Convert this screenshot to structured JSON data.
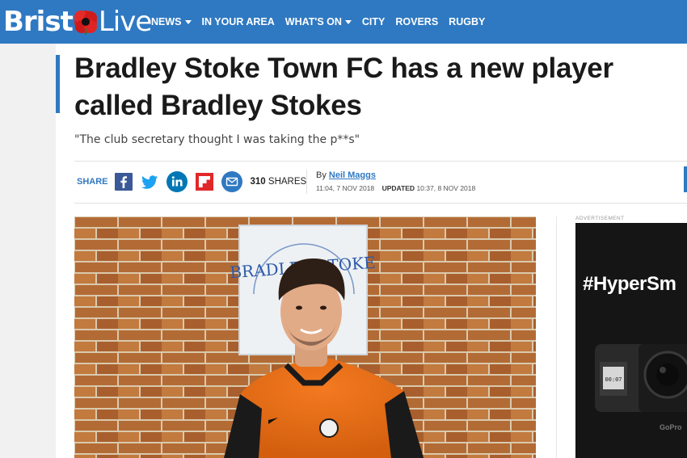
{
  "header": {
    "logo": {
      "left": "Brist",
      "right": "Live",
      "poppy_alt": "o"
    },
    "nav": [
      {
        "label": "NEWS",
        "dropdown": true
      },
      {
        "label": "IN YOUR AREA",
        "dropdown": false
      },
      {
        "label": "WHAT'S ON",
        "dropdown": true
      },
      {
        "label": "CITY",
        "dropdown": false
      },
      {
        "label": "ROVERS",
        "dropdown": false
      },
      {
        "label": "RUGBY",
        "dropdown": false
      }
    ]
  },
  "article": {
    "headline": "Bradley Stoke Town FC has a new player called Bradley Stokes",
    "standfirst": "\"The club secretary thought I was taking the p**s\"",
    "share": {
      "label": "SHARE",
      "buttons": [
        "facebook-icon",
        "twitter-icon",
        "linkedin-icon",
        "flipboard-icon",
        "email-icon"
      ],
      "count": "310",
      "count_suffix": "SHARES"
    },
    "byline": {
      "prefix": "By",
      "author": "Neil Maggs",
      "published": "11:04, 7 NOV 2018",
      "updated_label": "UPDATED",
      "updated": "10:37, 8 NOV 2018"
    },
    "photo": {
      "sign_text": "BRADLEY STOKE"
    }
  },
  "ad": {
    "label": "ADVERTISEMENT",
    "headline": "#HyperSm",
    "camera_screen": "00:07",
    "camera_brand": "GoPro"
  },
  "colors": {
    "brand_blue": "#2f79c2",
    "facebook": "#3b5998",
    "twitter": "#1da1f2",
    "linkedin": "#0077b5",
    "flipboard": "#e12828"
  }
}
